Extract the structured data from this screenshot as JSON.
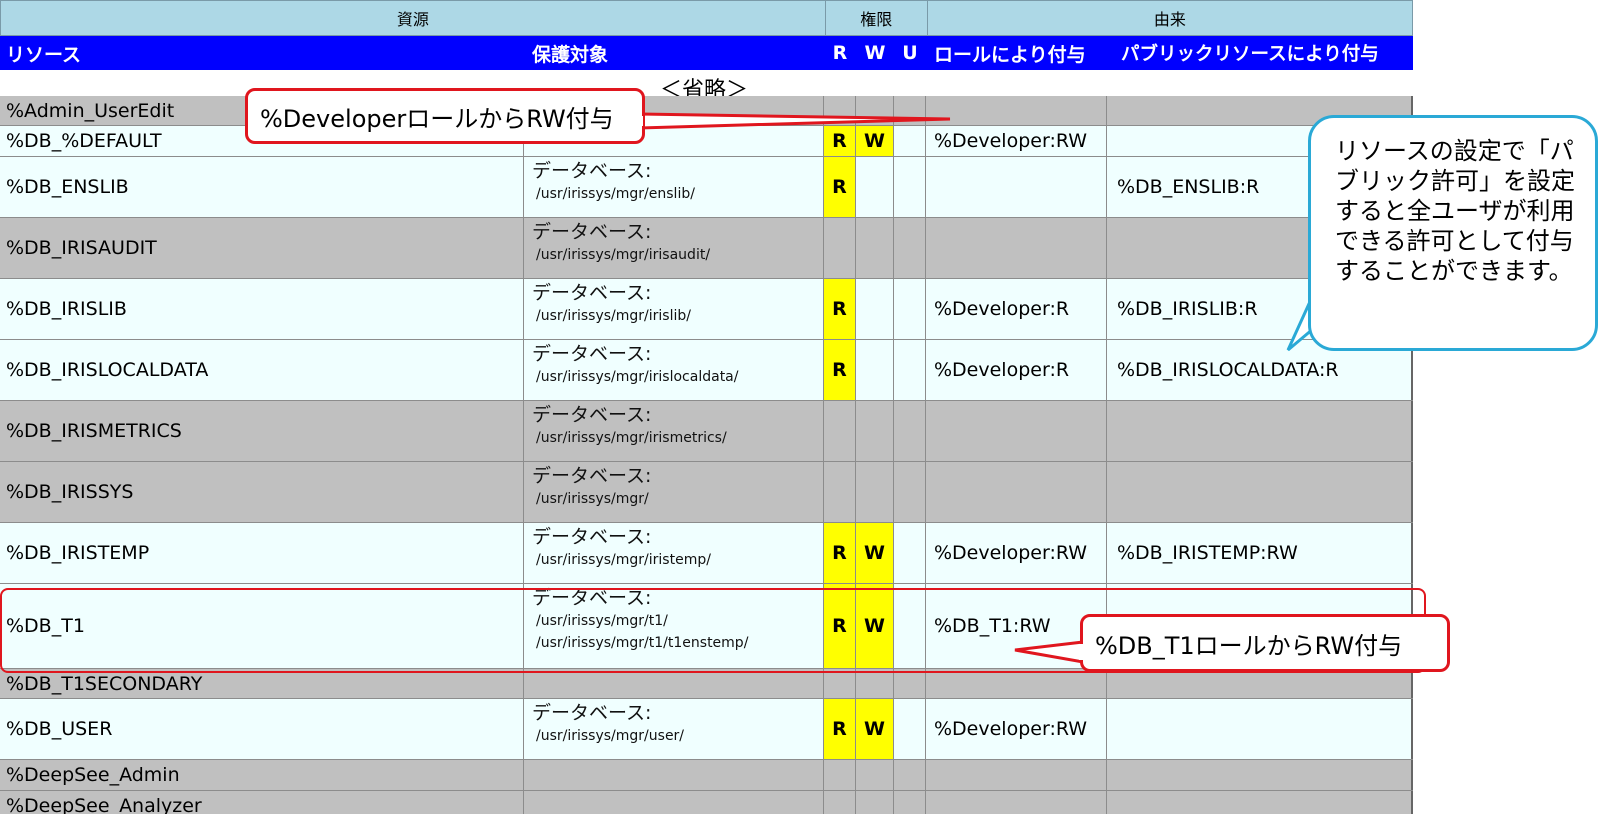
{
  "header": {
    "group_resource": "資源",
    "group_permission": "権限",
    "group_origin": "由来",
    "col_resource": "リソース",
    "col_protected": "保護対象",
    "col_r": "R",
    "col_w": "W",
    "col_u": "U",
    "col_by_role": "ロールにより付与",
    "col_by_public": "パブリックリソースにより付与"
  },
  "omitted_label": "＜省略＞",
  "rows": [
    {
      "resource": "%Admin_UserEdit",
      "label": "",
      "paths": [],
      "r": "",
      "w": "",
      "u": "",
      "role": "",
      "public": "",
      "shade": "gray"
    },
    {
      "resource": "%DB_%DEFAULT",
      "label": "",
      "paths": [],
      "r": "R",
      "w": "W",
      "u": "",
      "role": "%Developer:RW",
      "public": "",
      "shade": "light"
    },
    {
      "resource": "%DB_ENSLIB",
      "label": "データベース:",
      "paths": [
        "/usr/irissys/mgr/enslib/"
      ],
      "r": "R",
      "w": "",
      "u": "",
      "role": "",
      "public": "%DB_ENSLIB:R",
      "shade": "light"
    },
    {
      "resource": "%DB_IRISAUDIT",
      "label": "データベース:",
      "paths": [
        "/usr/irissys/mgr/irisaudit/"
      ],
      "r": "",
      "w": "",
      "u": "",
      "role": "",
      "public": "",
      "shade": "gray"
    },
    {
      "resource": "%DB_IRISLIB",
      "label": "データベース:",
      "paths": [
        "/usr/irissys/mgr/irislib/"
      ],
      "r": "R",
      "w": "",
      "u": "",
      "role": "%Developer:R",
      "public": "%DB_IRISLIB:R",
      "shade": "light"
    },
    {
      "resource": "%DB_IRISLOCALDATA",
      "label": "データベース:",
      "paths": [
        "/usr/irissys/mgr/irislocaldata/"
      ],
      "r": "R",
      "w": "",
      "u": "",
      "role": "%Developer:R",
      "public": "%DB_IRISLOCALDATA:R",
      "shade": "light"
    },
    {
      "resource": "%DB_IRISMETRICS",
      "label": "データベース:",
      "paths": [
        "/usr/irissys/mgr/irismetrics/"
      ],
      "r": "",
      "w": "",
      "u": "",
      "role": "",
      "public": "",
      "shade": "gray"
    },
    {
      "resource": "%DB_IRISSYS",
      "label": "データベース:",
      "paths": [
        "/usr/irissys/mgr/"
      ],
      "r": "",
      "w": "",
      "u": "",
      "role": "",
      "public": "",
      "shade": "gray"
    },
    {
      "resource": "%DB_IRISTEMP",
      "label": "データベース:",
      "paths": [
        "/usr/irissys/mgr/iristemp/"
      ],
      "r": "R",
      "w": "W",
      "u": "",
      "role": "%Developer:RW",
      "public": "%DB_IRISTEMP:RW",
      "shade": "light"
    },
    {
      "resource": "%DB_T1",
      "label": "データベース:",
      "paths": [
        "/usr/irissys/mgr/t1/",
        "/usr/irissys/mgr/t1/t1enstemp/"
      ],
      "r": "R",
      "w": "W",
      "u": "",
      "role": "%DB_T1:RW",
      "public": "",
      "shade": "light"
    },
    {
      "resource": "%DB_T1SECONDARY",
      "label": "",
      "paths": [],
      "r": "",
      "w": "",
      "u": "",
      "role": "",
      "public": "",
      "shade": "gray"
    },
    {
      "resource": "%DB_USER",
      "label": "データベース:",
      "paths": [
        "/usr/irissys/mgr/user/"
      ],
      "r": "R",
      "w": "W",
      "u": "",
      "role": "%Developer:RW",
      "public": "",
      "shade": "light"
    },
    {
      "resource": "%DeepSee_Admin",
      "label": "",
      "paths": [],
      "r": "",
      "w": "",
      "u": "",
      "role": "",
      "public": "",
      "shade": "gray"
    },
    {
      "resource": "%DeepSee_Analyzer",
      "label": "",
      "paths": [],
      "r": "",
      "w": "",
      "u": "",
      "role": "",
      "public": "",
      "shade": "gray"
    }
  ],
  "callouts": {
    "developer_rw": "%DeveloperロールからRW付与",
    "db_t1_rw": "%DB_T1ロールからRW付与",
    "public_note": "リソースの設定で「パブリック許可」を設定すると全ユーザが利用できる許可として付与することができます。"
  },
  "colors": {
    "header_group_bg": "#add8e6",
    "header_col_bg": "#0000ff",
    "row_gray": "#c0c0c0",
    "row_light": "#f0ffff",
    "permission_yellow": "#ffff00",
    "callout_red": "#e0161e",
    "callout_blue": "#2aa9d6"
  }
}
